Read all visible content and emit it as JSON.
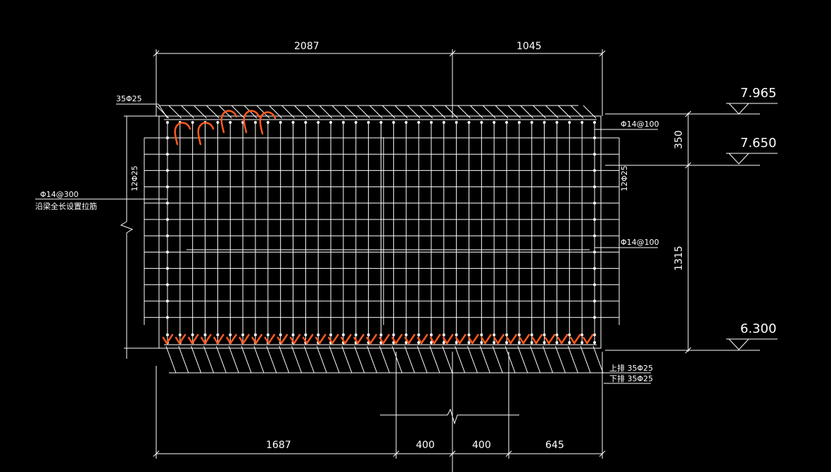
{
  "drawing": {
    "top_dimensions": [
      "2087",
      "1045"
    ],
    "bottom_dimensions": [
      "1687",
      "400",
      "400",
      "645"
    ],
    "right_dimensions": [
      "350",
      "1315"
    ],
    "elevations": [
      "7.965",
      "7.650",
      "6.300"
    ],
    "annotations": {
      "top_bars": "35Φ25",
      "left_side_bars": "12Φ25",
      "right_side_bars": "12Φ25",
      "stirrup_top": "Φ14@100",
      "stirrup_mid": "Φ14@100",
      "tie_bar_spec": "Φ14@300",
      "tie_bar_note": "沿梁全长设置拉筋",
      "bottom_upper_row": "上排 35Φ25",
      "bottom_lower_row": "下排 35Φ25"
    },
    "colors": {
      "background": "#000000",
      "lines": "#ffffff",
      "markup": "#ff5a1f"
    }
  }
}
